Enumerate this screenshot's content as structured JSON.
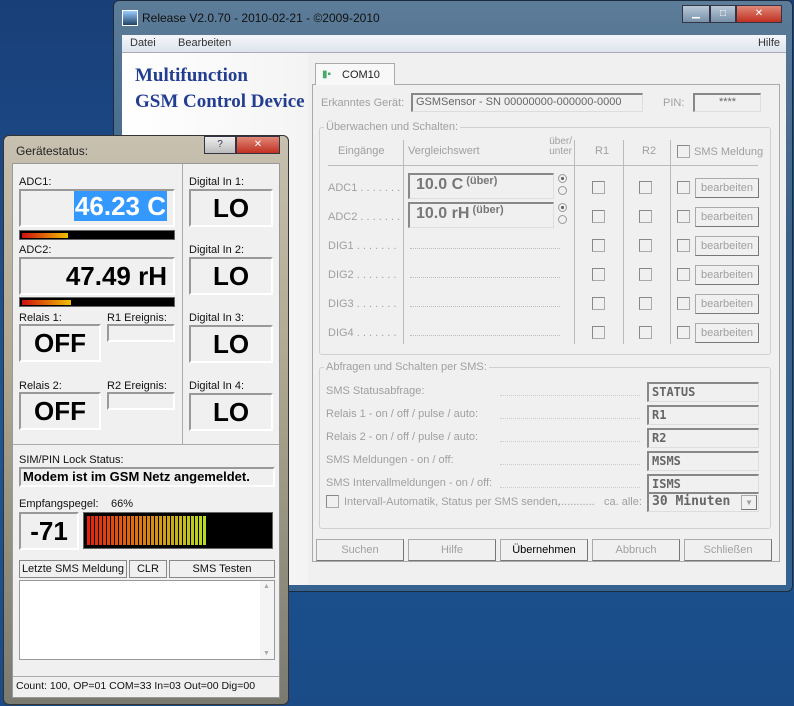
{
  "main_window": {
    "title": "Release V2.0.70 - 2010-02-21 - ©2009-2010",
    "menu": [
      "Datei",
      "Bearbeiten",
      "Hilfe"
    ],
    "logo": [
      "Multifunction",
      "GSM Control Device"
    ],
    "tab": "COM10",
    "device_label": "Erkanntes Gerät:",
    "device_value": "GSMSensor - SN 00000000-000000-0000",
    "pin_label": "PIN:",
    "pin_value": "****",
    "monitor": {
      "title": "Überwachen und Schalten:",
      "headers": {
        "inputs": "Eingänge",
        "compare": "Vergleichswert",
        "over_under": "über/ unter",
        "r1": "R1",
        "r2": "R2",
        "sms": "SMS Meldung"
      },
      "rows": [
        {
          "name": "ADC1 . . . . . . .",
          "value": "10.0 C",
          "mode": "(über)"
        },
        {
          "name": "ADC2 . . . . . . .",
          "value": "10.0 rH",
          "mode": "(über)"
        },
        {
          "name": "DIG1 . . . . . . ."
        },
        {
          "name": "DIG2 . . . . . . ."
        },
        {
          "name": "DIG3 . . . . . . ."
        },
        {
          "name": "DIG4 . . . . . . ."
        }
      ],
      "edit_label": "bearbeiten"
    },
    "sms": {
      "title": "Abfragen und Schalten per SMS:",
      "rows": [
        {
          "label": "SMS Statusabfrage:",
          "value": "STATUS"
        },
        {
          "label": "Relais 1 - on / off / pulse / auto:",
          "value": "R1"
        },
        {
          "label": "Relais 2 - on / off / pulse / auto:",
          "value": "R2"
        },
        {
          "label": "SMS Meldungen - on / off:",
          "value": "MSMS"
        },
        {
          "label": "SMS Intervallmeldungen - on / off:",
          "value": "ISMS"
        }
      ],
      "interval_label": "Intervall-Automatik, Status per SMS senden,",
      "interval_suffix": "ca. alle:",
      "interval_value": "30 Minuten"
    },
    "buttons": [
      "Suchen",
      "Hilfe",
      "Übernehmen",
      "Abbruch",
      "Schließen"
    ]
  },
  "status_dialog": {
    "title": "Gerätestatus:",
    "adc1_label": "ADC1:",
    "adc1_value": "46.23 C",
    "adc1_level": 0.3,
    "adc2_label": "ADC2:",
    "adc2_value": "47.49 rH",
    "adc2_level": 0.32,
    "relais1_label": "Relais 1:",
    "relais1_value": "OFF",
    "r1_event_label": "R1 Ereignis:",
    "relais2_label": "Relais 2:",
    "relais2_value": "OFF",
    "r2_event_label": "R2 Ereignis:",
    "digital": [
      {
        "label": "Digital In 1:",
        "value": "LO"
      },
      {
        "label": "Digital In 2:",
        "value": "LO"
      },
      {
        "label": "Digital In 3:",
        "value": "LO"
      },
      {
        "label": "Digital In 4:",
        "value": "LO"
      }
    ],
    "sim_label": "SIM/PIN Lock Status:",
    "sim_value": "Modem ist im GSM Netz angemeldet.",
    "signal_label": "Empfangspegel:",
    "signal_percent": "66%",
    "signal_level": 0.66,
    "signal_value": "-71",
    "buttons": [
      "Letzte SMS Meldung",
      "CLR",
      "SMS Testen"
    ],
    "status_line": "Count: 100, OP=01 COM=33 In=03 Out=00 Dig=00"
  }
}
